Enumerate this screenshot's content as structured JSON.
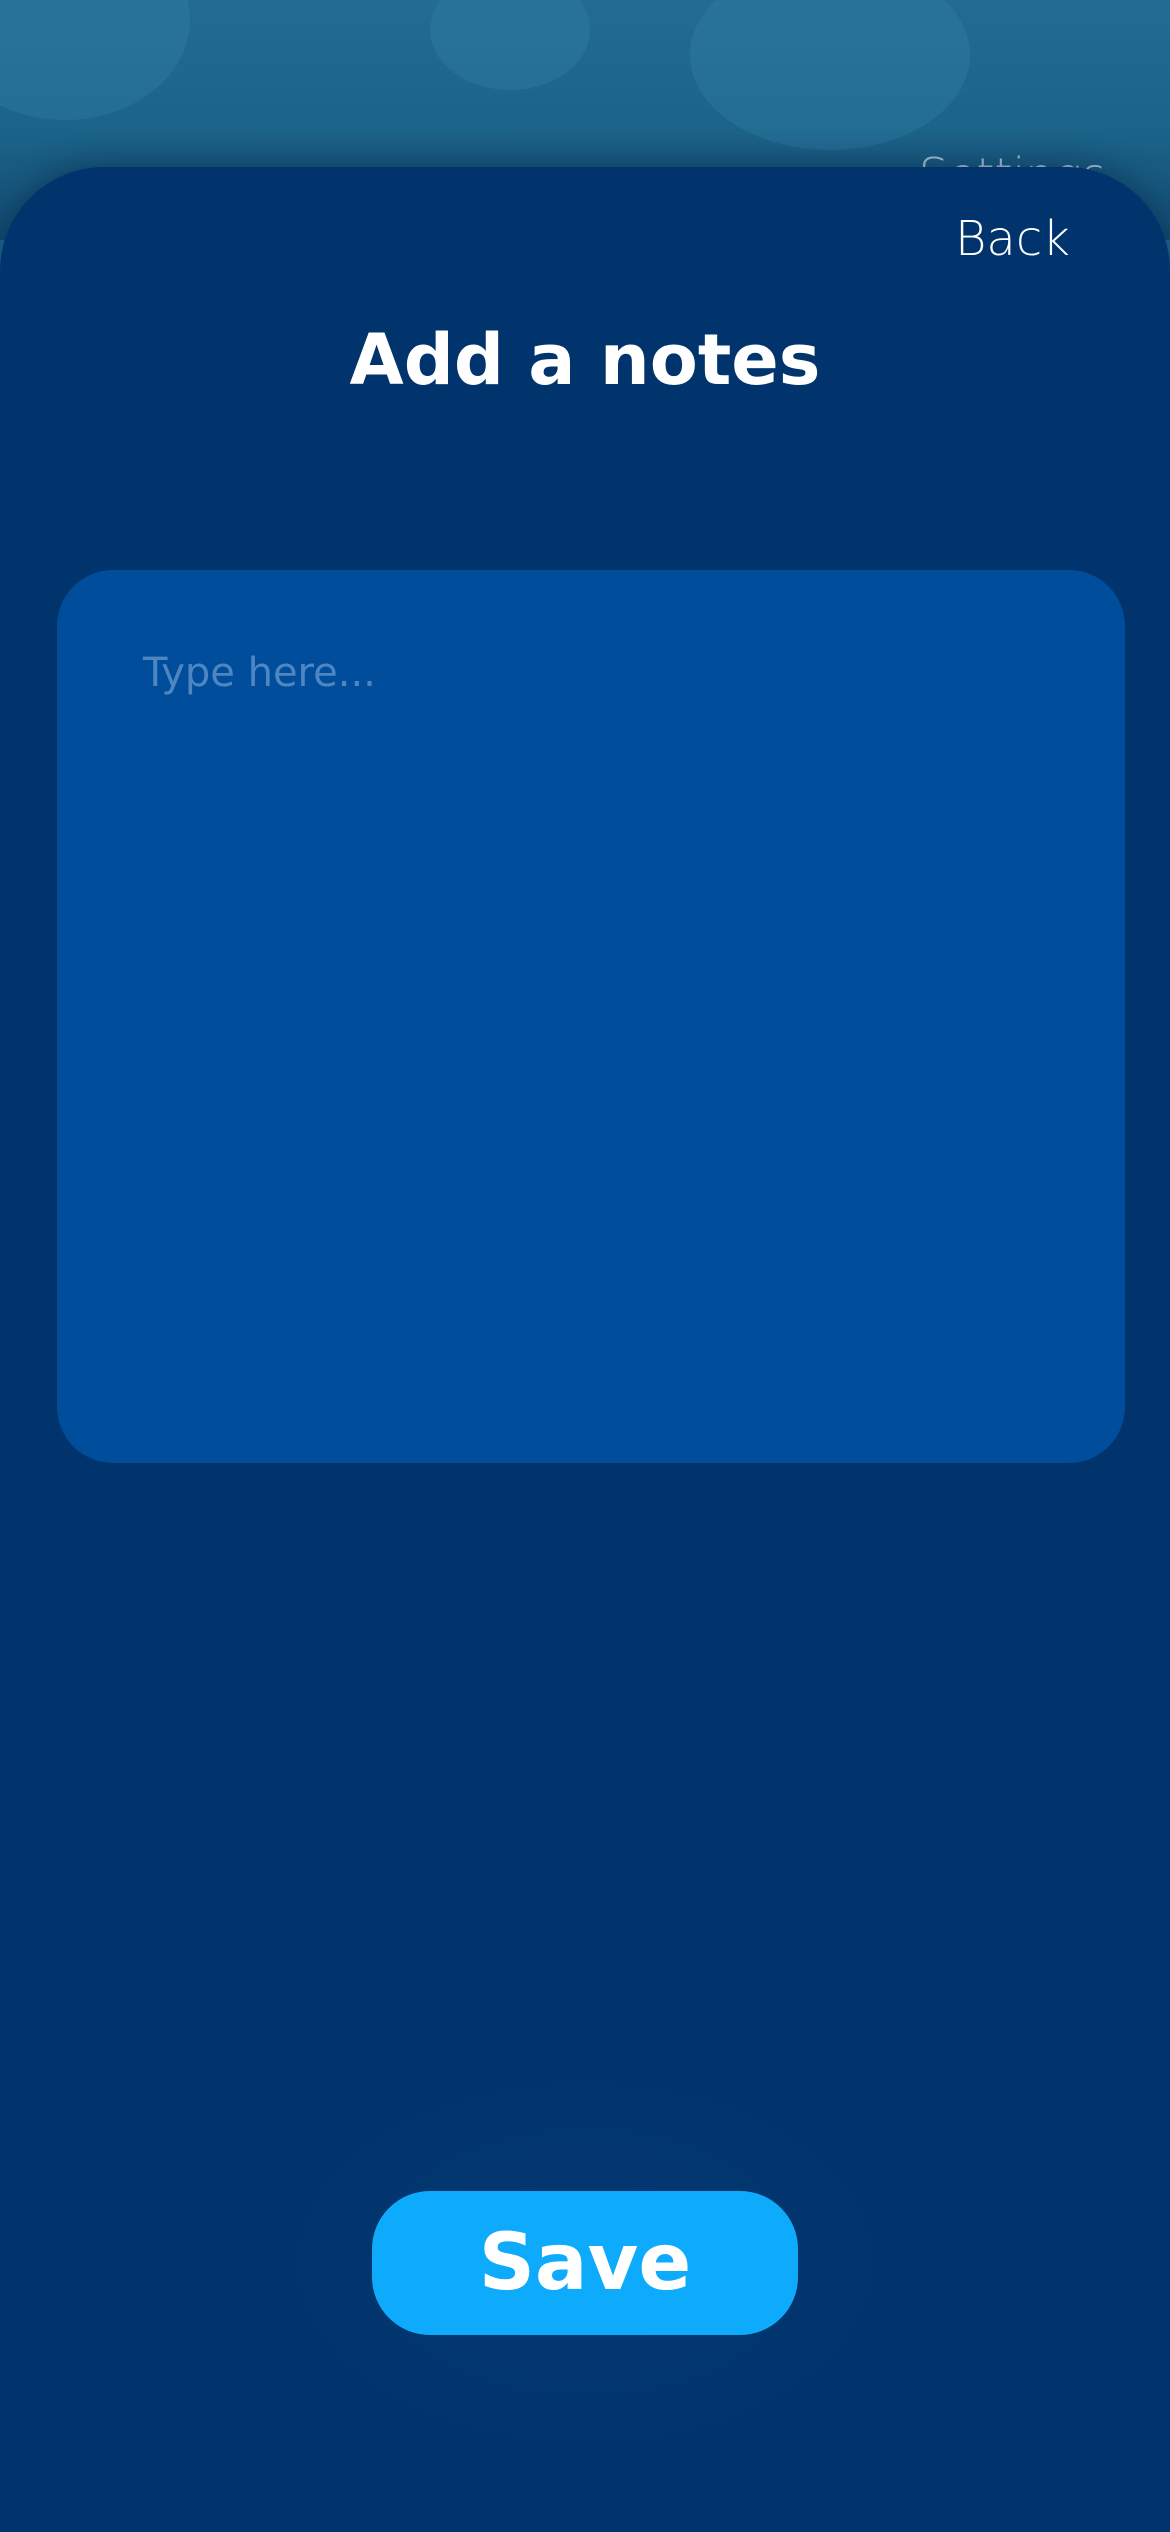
{
  "background": {
    "settings_label": "Settings"
  },
  "header": {
    "back_label": "Back",
    "title": "Add a notes"
  },
  "note": {
    "value": "",
    "placeholder": "Type here..."
  },
  "footer": {
    "save_label": "Save"
  },
  "colors": {
    "sheet": "#01346c",
    "input_box": "#004d9b",
    "accent": "#0eaafb",
    "placeholder": "#4e86c2"
  }
}
